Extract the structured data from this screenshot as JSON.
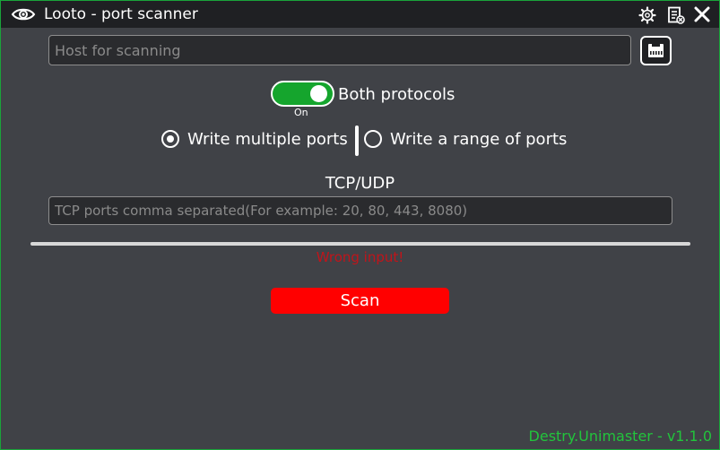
{
  "window": {
    "title": "Looto - port scanner",
    "icons": [
      "eye-icon",
      "gear-icon",
      "log-icon",
      "close-icon"
    ]
  },
  "host": {
    "placeholder": "Host for scanning",
    "value": ""
  },
  "network_button": {
    "icon": "ethernet-port-icon"
  },
  "protocol_toggle": {
    "state": "On",
    "label": "Both protocols",
    "on": true
  },
  "port_mode": {
    "options": [
      {
        "label": "Write multiple ports",
        "selected": true
      },
      {
        "label": "Write a range of ports",
        "selected": false
      }
    ]
  },
  "ports": {
    "protocol_label": "TCP/UDP",
    "placeholder": "TCP ports comma separated(For example: 20, 80, 443, 8080)",
    "value": ""
  },
  "progress": {
    "value": 0
  },
  "error": {
    "message": "Wrong input!"
  },
  "scan": {
    "label": "Scan"
  },
  "footer": {
    "credit": "Destry.Unimaster - v1.1.0"
  },
  "colors": {
    "accent_green": "#15a52d",
    "border_green": "#1aa33a",
    "scan_red": "#ff0000",
    "error_red": "#c0141a",
    "background": "#404247",
    "titlebar": "#1f2023"
  }
}
